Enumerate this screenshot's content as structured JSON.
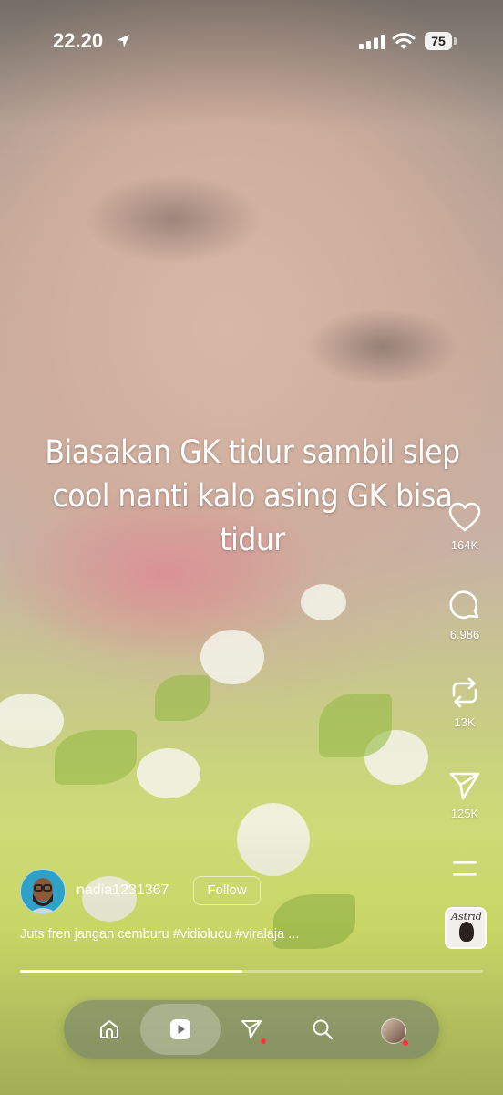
{
  "status_bar": {
    "time": "22.20",
    "battery": "75"
  },
  "caption": "Biasakan GK tidur sambil slep cool nanti kalo asing GK bisa tidur",
  "actions": {
    "likes": "164K",
    "comments": "6.986",
    "reposts": "13K",
    "shares": "125K"
  },
  "author": {
    "username": "nadia1231367",
    "follow_label": "Follow"
  },
  "description": "Juts fren jangan cemburu #vidiolucu #viralaja ...",
  "audio": {
    "label": "Astrid"
  },
  "playback": {
    "progress": 0.48
  },
  "nav": {
    "items": [
      "home-icon",
      "reels-icon",
      "direct-icon",
      "search-icon",
      "profile-avatar"
    ],
    "active": "reels"
  }
}
